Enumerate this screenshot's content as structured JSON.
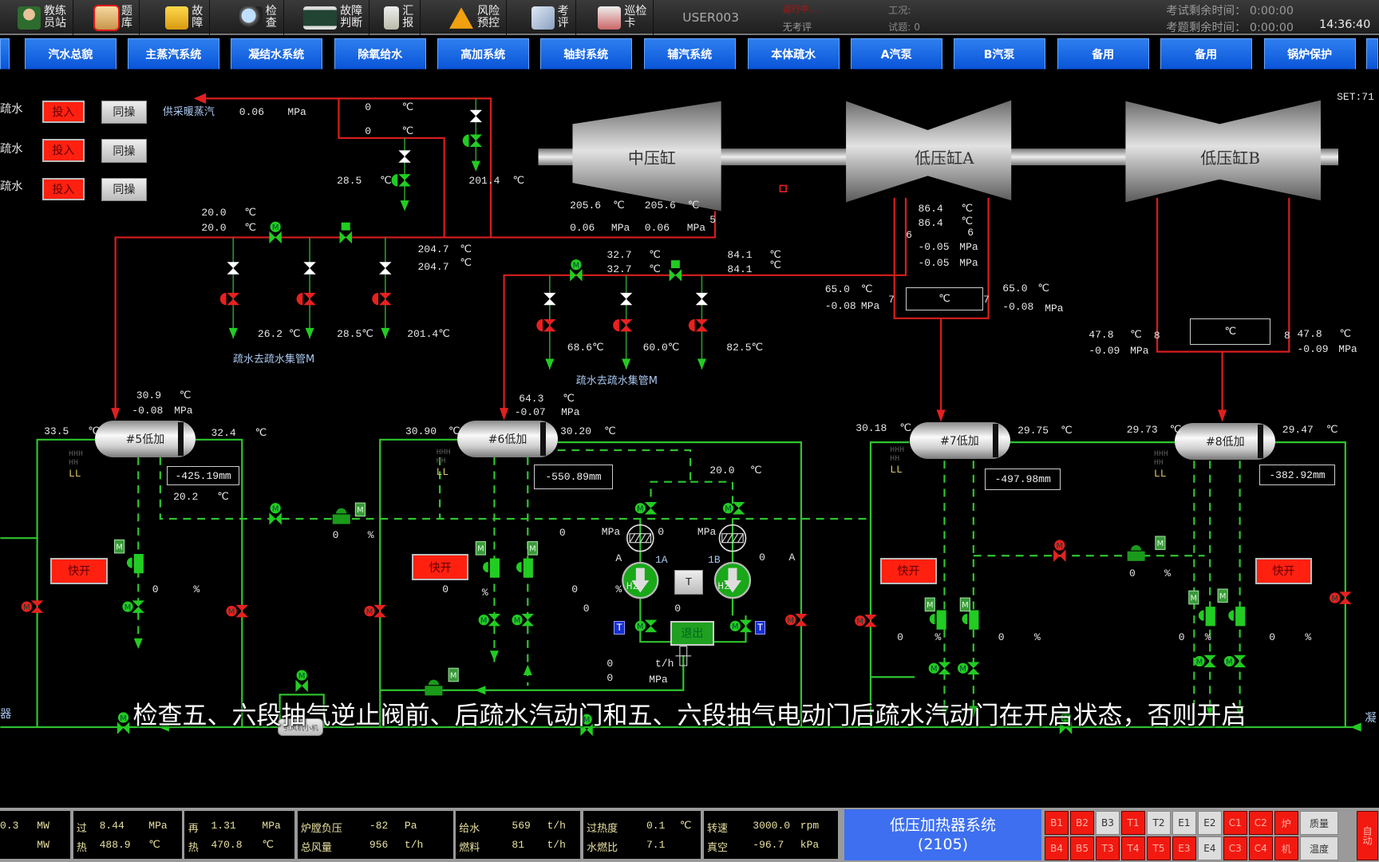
{
  "toolbar": {
    "items": [
      {
        "label": "教练\n员站",
        "icon": "instructor-icon"
      },
      {
        "label": "题\n库",
        "icon": "folder-icon",
        "selected": true
      },
      {
        "label": "故\n障",
        "icon": "fault-icon"
      },
      {
        "label": "检\n查",
        "icon": "magnifier-icon"
      },
      {
        "label": "故障\n判断",
        "icon": "trend-icon"
      },
      {
        "label": "汇\n报",
        "icon": "clipboard-icon"
      },
      {
        "label": "风险\n预控",
        "icon": "warning-icon"
      },
      {
        "label": "考\n评",
        "icon": "evaluation-icon"
      },
      {
        "label": "巡检\n卡",
        "icon": "inspection-card-icon"
      }
    ],
    "user": "USER003",
    "run_state": "运行中...",
    "eval_state": "无考评",
    "condition": "工况:",
    "questions": "试题: 0",
    "exam_time": "考试剩余时间： 0:00:00",
    "question_time": "考题剩余时间： 0:00:00",
    "clock": "14:36:40"
  },
  "nav": [
    "汽水总貌",
    "主蒸汽系统",
    "凝结水系统",
    "除氧给水",
    "高加系统",
    "轴封系统",
    "辅汽系统",
    "本体疏水",
    "A汽泵",
    "B汽泵",
    "备用",
    "备用",
    "锅炉保护"
  ],
  "diagram": {
    "set": "SET:71",
    "drain_rows": [
      {
        "label": "疏水",
        "in": "投入",
        "sync": "同操"
      },
      {
        "label": "疏水",
        "in": "投入",
        "sync": "同操"
      },
      {
        "label": "疏水",
        "in": "投入",
        "sync": "同操"
      }
    ],
    "heating_steam": {
      "label": "供采暖蒸汽",
      "value": "0.06",
      "unit": "MPa"
    },
    "turbines": [
      "中压缸",
      "低压缸A",
      "低压缸B"
    ],
    "upper_values": [
      "0",
      "℃",
      "0",
      "℃",
      "28.5",
      "℃",
      "201.4",
      "℃",
      "20.0",
      "℃",
      "20.0",
      "℃",
      "204.7",
      "℃",
      "204.7",
      "℃",
      "26.2 ℃",
      "28.5℃",
      "201.4℃",
      "205.6",
      "℃",
      "205.6",
      "℃",
      "0.06",
      "MPa",
      "0.06",
      "MPa",
      "5",
      "32.7",
      "℃",
      "32.7",
      "℃",
      "84.1",
      "℃",
      "84.1",
      "℃",
      "86.4",
      "℃",
      "86.4",
      "℃",
      "6",
      "6",
      "-0.05",
      "MPa",
      "-0.05",
      "MPa",
      "65.0",
      "℃",
      "-0.08",
      "MPa",
      "7",
      "-0.08  MPa",
      "7",
      "65.0",
      "℃",
      "-0.08",
      "MPa",
      "47.8",
      "℃",
      "-0.09",
      "MPa",
      "8",
      "-0.09  MPa",
      "8",
      "47.8",
      "℃",
      "-0.09",
      "MPa",
      "68.6℃",
      "60.0℃",
      "82.5℃"
    ],
    "drain_header_labels": [
      "疏水去疏水集管M",
      "疏水去疏水集管M"
    ],
    "heaters": [
      {
        "name": "#5低加",
        "in_temp": "33.5",
        "out_temp": "32.4",
        "steam_temp": "30.9",
        "steam_press": "-0.08",
        "level": "-425.19mm",
        "drain_temp": "20.2"
      },
      {
        "name": "#6低加",
        "in_temp": "30.90",
        "out_temp": "30.20",
        "steam_temp": "64.3",
        "steam_press": "-0.07",
        "level": "-550.89mm",
        "drain_temp": "20.0"
      },
      {
        "name": "#7低加",
        "in_temp": "30.18",
        "out_temp": "29.75",
        "level": "-497.98mm"
      },
      {
        "name": "#8低加",
        "in_temp": "29.73",
        "out_temp": "29.47",
        "level": "-382.92mm"
      }
    ],
    "units": {
      "c": "℃",
      "mpa": "MPa",
      "pct": "%",
      "hz": "Hz",
      "th": "t/h",
      "a": "A"
    },
    "level_marks": [
      "HHH",
      "HH",
      "LL"
    ],
    "quick_open": "快开",
    "zero": "0",
    "pumps": {
      "a": "1A",
      "b": "1B",
      "t_button": "T",
      "exit_button": "退出",
      "t_tag": "T"
    },
    "edge_left": "器",
    "edge_right": "凝",
    "small_pump": "引风机小机"
  },
  "subtitle": "检查五、六段抽气逆止阀前、后疏水汽动门和五、六段抽气电动门后疏水汽动门在开启状态，否则开启",
  "status": {
    "power": {
      "v1": "0.3",
      "u1": "MW",
      "u2": "MW"
    },
    "main_steam": {
      "l1": "过",
      "v1": "8.44",
      "u1": "MPa",
      "l2": "热",
      "v2": "488.9",
      "u2": "℃"
    },
    "reheat": {
      "l1": "再",
      "v1": "1.31",
      "u1": "MPa",
      "l2": "热",
      "v2": "470.8",
      "u2": "℃"
    },
    "furnace": {
      "l1": "炉膛负压",
      "v1": "-82",
      "u1": "Pa",
      "l2": "总风量",
      "v2": "956",
      "u2": "t/h"
    },
    "feed": {
      "l1": "给水",
      "v1": "569",
      "u1": "t/h",
      "l2": "燃料",
      "v2": "81",
      "u2": "t/h"
    },
    "superheat": {
      "l1": "过热度",
      "v1": "0.1",
      "u1": "℃",
      "l2": "水燃比",
      "v2": "7.1"
    },
    "speed": {
      "l1": "转速",
      "v1": "3000.0",
      "u1": "rpm",
      "l2": "真空",
      "v2": "-96.7",
      "u2": "kPa"
    },
    "system_name": "低压加热器系统",
    "system_code": "(2105)",
    "row1": [
      {
        "t": "B1",
        "on": true
      },
      {
        "t": "B2",
        "on": true
      },
      {
        "t": "B3",
        "on": false
      },
      {
        "t": "T1",
        "on": true
      },
      {
        "t": "T2",
        "on": false
      },
      {
        "t": "E1",
        "on": false
      },
      {
        "t": "E2",
        "on": false
      },
      {
        "t": "C1",
        "on": true
      },
      {
        "t": "C2",
        "on": true
      },
      {
        "t": "炉",
        "on": true
      },
      {
        "t": "质量",
        "on": false
      }
    ],
    "row2": [
      {
        "t": "B4",
        "on": true
      },
      {
        "t": "B5",
        "on": true
      },
      {
        "t": "T3",
        "on": true
      },
      {
        "t": "T4",
        "on": true
      },
      {
        "t": "T5",
        "on": true
      },
      {
        "t": "E3",
        "on": true
      },
      {
        "t": "E4",
        "on": false
      },
      {
        "t": "C3",
        "on": true
      },
      {
        "t": "C4",
        "on": true
      },
      {
        "t": "机",
        "on": true
      },
      {
        "t": "温度",
        "on": false
      }
    ],
    "auto": "自动",
    "colors": {
      "on": "#f21a10",
      "off": "#dddddd",
      "system": "#3d6ff0"
    }
  }
}
